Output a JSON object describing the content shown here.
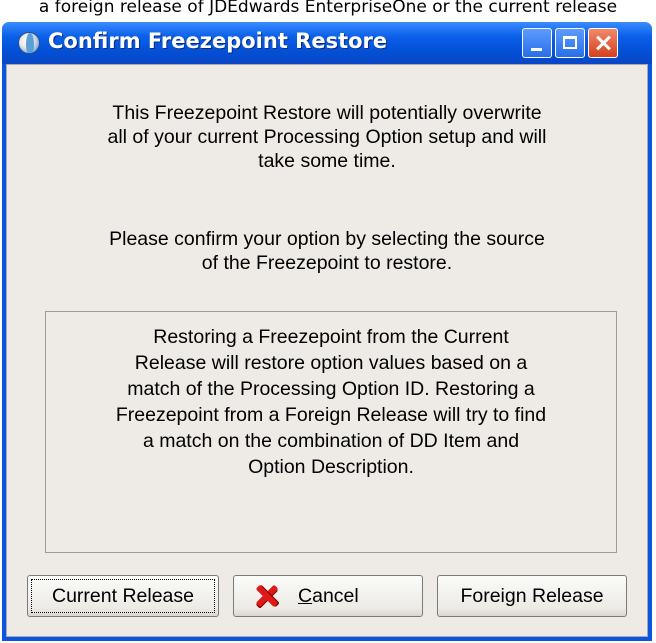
{
  "caption": "a foreign release of JDEdwards EnterpriseOne or the current release",
  "window": {
    "title": "Confirm Freezepoint Restore",
    "icon": "globe-icon"
  },
  "titlebar_buttons": {
    "minimize_icon": "minimize-icon",
    "maximize_icon": "maximize-icon",
    "close_icon": "close-icon"
  },
  "message": {
    "line1": "This Freezepoint Restore will potentially overwrite",
    "line2": "all of your current Processing Option setup and will",
    "line3": "take some time.",
    "line4": "Please confirm your option by selecting the source",
    "line5": "of the Freezepoint to restore."
  },
  "info": {
    "line1": "Restoring a Freezepoint from the Current",
    "line2": "Release will restore option values based on a",
    "line3": "match of the Processing Option ID. Restoring a",
    "line4": "Freezepoint from a Foreign Release will try to find",
    "line5": "a match on the combination of DD Item and",
    "line6": "Option Description."
  },
  "buttons": {
    "current_release": "Current Release",
    "cancel_mnemonic": "C",
    "cancel_rest": "ancel",
    "foreign_release": "Foreign Release"
  },
  "colors": {
    "title_bar": "#0a5fe8",
    "client_bg": "#eeebe6",
    "cancel_x": "#e01818"
  }
}
